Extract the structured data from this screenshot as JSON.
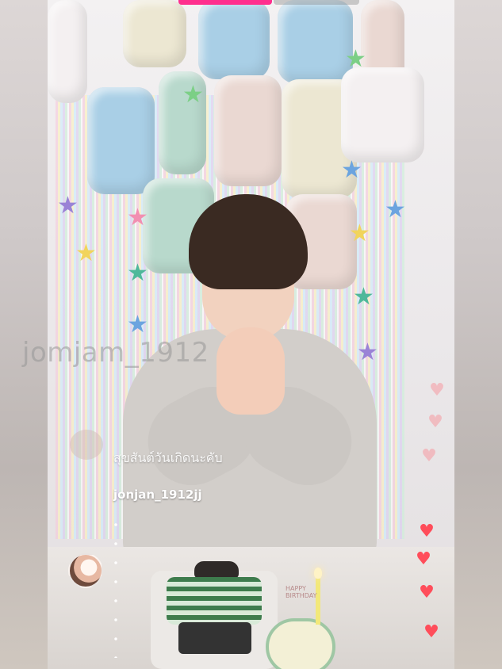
{
  "overlay": {
    "watermark": "jomjam_1912",
    "comment_text": "สุขสันต์วันเกิดนะคับ",
    "username": "jonjan_1912jj",
    "progress": 0.52
  },
  "decor": {
    "balloon_text": "HAPPY BIRTHDAY"
  },
  "cake": {
    "label": "HAPPY BIRTHDAY"
  },
  "colors": {
    "progress_accent": "#ff2f8e",
    "heart": "#ff4d5a",
    "username_text": "#ffffff"
  },
  "icons": {
    "heart": "heart-icon",
    "avatar": "avatar"
  }
}
